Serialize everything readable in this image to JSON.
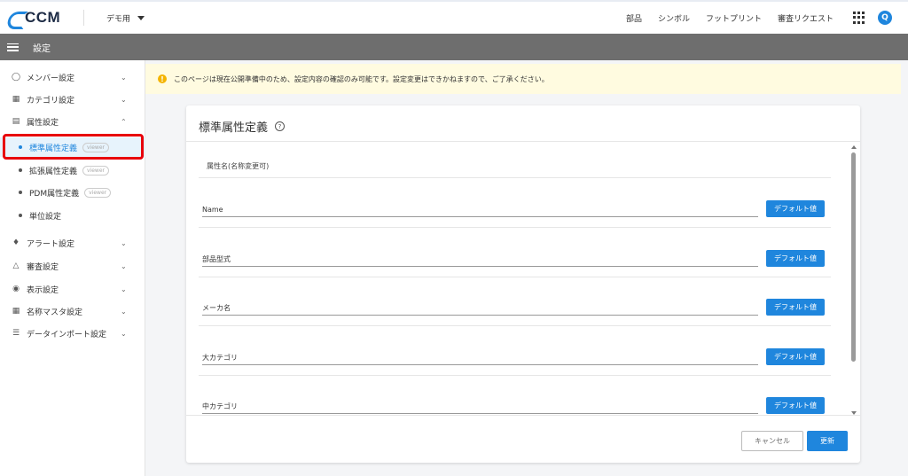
{
  "header": {
    "logo_text": "CCM",
    "env_label": "デモ用",
    "nav": [
      "部品",
      "シンボル",
      "フットプリント",
      "審査リクエスト"
    ],
    "avatar_initial": "Q",
    "brand_color": "#1f86dd"
  },
  "titlebar": {
    "title": "設定"
  },
  "sidebar": {
    "groups_top": [
      {
        "label": "メンバー設定",
        "icon": "user-icon"
      },
      {
        "label": "カテゴリ設定",
        "icon": "grid-icon"
      },
      {
        "label": "属性設定",
        "icon": "document-icon"
      }
    ],
    "attribute_items": [
      {
        "label": "標準属性定義",
        "badge": "viewer",
        "active": true
      },
      {
        "label": "拡張属性定義",
        "badge": "viewer"
      },
      {
        "label": "PDM属性定義",
        "badge": "viewer"
      },
      {
        "label": "単位設定"
      }
    ],
    "groups_bottom": [
      {
        "label": "アラート設定",
        "icon": "bell-icon"
      },
      {
        "label": "審査設定",
        "icon": "stamp-icon"
      },
      {
        "label": "表示設定",
        "icon": "eye-icon"
      },
      {
        "label": "名称マスタ設定",
        "icon": "table-icon"
      },
      {
        "label": "データインポート設定",
        "icon": "database-icon"
      }
    ]
  },
  "notice": {
    "text": "このページは現在公開準備中のため、設定内容の確認のみ可能です。設定変更はできかねますので、ご了承ください。"
  },
  "card": {
    "title": "標準属性定義",
    "column_header": "属性名(名称変更可)",
    "rows": [
      {
        "name": "Name",
        "button": "デフォルト値"
      },
      {
        "name": "部品型式",
        "button": "デフォルト値"
      },
      {
        "name": "メーカ名",
        "button": "デフォルト値"
      },
      {
        "name": "大カテゴリ",
        "button": "デフォルト値"
      },
      {
        "name": "中カテゴリ",
        "button": "デフォルト値"
      }
    ],
    "cancel_label": "キャンセル",
    "update_label": "更新"
  }
}
